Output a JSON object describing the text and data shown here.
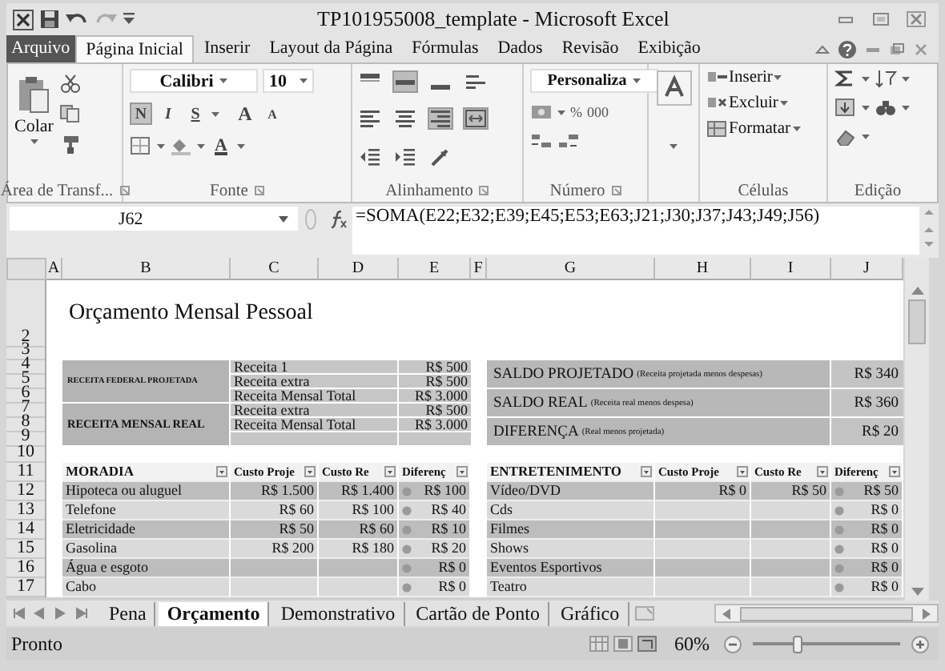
{
  "window": {
    "title": "TP101955008_template - Microsoft Excel"
  },
  "ribbon_tabs": [
    {
      "label": "Arquivo",
      "kind": "file",
      "selected": false
    },
    {
      "label": "Página Inicial",
      "kind": "tab",
      "selected": true
    },
    {
      "label": "Inserir",
      "kind": "tab",
      "selected": false
    },
    {
      "label": "Layout da Página",
      "kind": "tab",
      "selected": false
    },
    {
      "label": "Fórmulas",
      "kind": "tab",
      "selected": false
    },
    {
      "label": "Dados",
      "kind": "tab",
      "selected": false
    },
    {
      "label": "Revisão",
      "kind": "tab",
      "selected": false
    },
    {
      "label": "Exibição",
      "kind": "tab",
      "selected": false
    }
  ],
  "ribbon": {
    "groups": [
      {
        "kind": "clipboard",
        "label": "Área de Transf...",
        "paste": "Colar"
      },
      {
        "kind": "font",
        "label": "Fonte",
        "font": "Calibri",
        "size": "10",
        "bold": "N",
        "bold_on": true,
        "italic": "I",
        "underline": "S",
        "grow": "A",
        "shrink": "A",
        "font_color_label": "A"
      },
      {
        "kind": "alignment",
        "label": "Alinhamento",
        "buttons": [
          {
            "kind": "align-top",
            "pressed": false
          },
          {
            "kind": "align-middle",
            "pressed": true
          },
          {
            "kind": "align-bottom",
            "pressed": false
          },
          {
            "kind": "wrap",
            "pressed": false
          },
          {
            "kind": "align-left",
            "pressed": false
          },
          {
            "kind": "align-center",
            "pressed": false
          },
          {
            "kind": "align-right",
            "pressed": true
          },
          {
            "kind": "merge",
            "pressed": true
          },
          {
            "kind": "outdent",
            "pressed": false
          },
          {
            "kind": "indent",
            "pressed": false
          },
          {
            "kind": "orientation",
            "pressed": false
          }
        ]
      },
      {
        "kind": "number",
        "label": "Número",
        "format": "Personaliza",
        "percent": "%",
        "thousands": "000"
      },
      {
        "kind": "styles"
      },
      {
        "kind": "cells",
        "label": "Células",
        "buttons": [
          "Inserir",
          "Excluir",
          "Formatar"
        ]
      },
      {
        "kind": "editing",
        "label": "Edição"
      }
    ]
  },
  "formula_bar": {
    "name_box": "J62",
    "formula": "=SOMA(E22;E32;E39;E45;E53;E63;J21;J30;J37;J43;J49;J56)"
  },
  "sheet": {
    "columns": [
      "A",
      "B",
      "C",
      "D",
      "E",
      "F",
      "G",
      "H",
      "I",
      "J"
    ],
    "rows": [
      "2",
      "3",
      "4",
      "5",
      "6",
      "7",
      "8",
      "9",
      "10",
      "11",
      "12",
      "13",
      "14",
      "15",
      "16",
      "17"
    ],
    "title": "Orçamento Mensal Pessoal",
    "income_groups": [
      {
        "label": "RECEITA FEDERAL PROJETADA",
        "items": [
          {
            "name": "Receita 1",
            "amount": "R$ 500"
          },
          {
            "name": "Receita extra",
            "amount": "R$ 500"
          },
          {
            "name": "Receita Mensal Total",
            "amount": "R$ 3.000"
          }
        ]
      },
      {
        "label": "RECEITA MENSAL REAL",
        "items": [
          {
            "name": "Receita extra",
            "amount": "R$ 500"
          },
          {
            "name": "Receita Mensal Total",
            "amount": "R$ 3.000"
          }
        ]
      }
    ],
    "summary": [
      {
        "label": "SALDO PROJETADO",
        "note": "(Receita projetada menos despesas)",
        "value": "R$ 340"
      },
      {
        "label": "SALDO REAL",
        "note": "(Receita real menos despesa)",
        "value": "R$ 360"
      },
      {
        "label": "DIFERENÇA",
        "note": "(Real menos projetada)",
        "value": "R$ 20"
      }
    ],
    "tables": [
      {
        "title": "MORADIA",
        "columns": [
          "Custo Proje",
          "Custo Re",
          "Diferenç"
        ],
        "rows": [
          {
            "name": "Hipoteca ou aluguel",
            "projected": "R$ 1.500",
            "actual": "R$ 1.400",
            "difference": "R$ 100"
          },
          {
            "name": "Telefone",
            "projected": "R$ 60",
            "actual": "R$ 100",
            "difference": "R$ 40"
          },
          {
            "name": "Eletricidade",
            "projected": "R$ 50",
            "actual": "R$ 60",
            "difference": "R$ 10"
          },
          {
            "name": "Gasolina",
            "projected": "R$ 200",
            "actual": "R$ 180",
            "difference": "R$ 20"
          },
          {
            "name": "Água e esgoto",
            "difference": "R$ 0"
          },
          {
            "name": "Cabo",
            "difference": "R$ 0"
          }
        ]
      },
      {
        "title": "ENTRETENIMENTO",
        "columns": [
          "Custo Proje",
          "Custo Re",
          "Diferenç"
        ],
        "rows": [
          {
            "name": "Vídeo/DVD",
            "projected": "R$ 0",
            "actual": "R$ 50",
            "difference": "R$ 50"
          },
          {
            "name": "Cds",
            "difference": "R$ 0"
          },
          {
            "name": "Filmes",
            "difference": "R$ 0"
          },
          {
            "name": "Shows",
            "difference": "R$ 0"
          },
          {
            "name": "Eventos Esportivos",
            "difference": "R$ 0"
          },
          {
            "name": "Teatro",
            "difference": "R$ 0"
          }
        ]
      }
    ]
  },
  "sheet_tabs": [
    {
      "label": "Pena",
      "selected": false
    },
    {
      "label": "Orçamento",
      "selected": true
    },
    {
      "label": "Demonstrativo",
      "selected": false
    },
    {
      "label": "Cartão de Ponto",
      "selected": false
    },
    {
      "label": "Gráfico",
      "selected": false
    }
  ],
  "status_bar": {
    "status": "Pronto",
    "zoom": "60%",
    "zoom_slider": {
      "level": 0.3
    }
  }
}
